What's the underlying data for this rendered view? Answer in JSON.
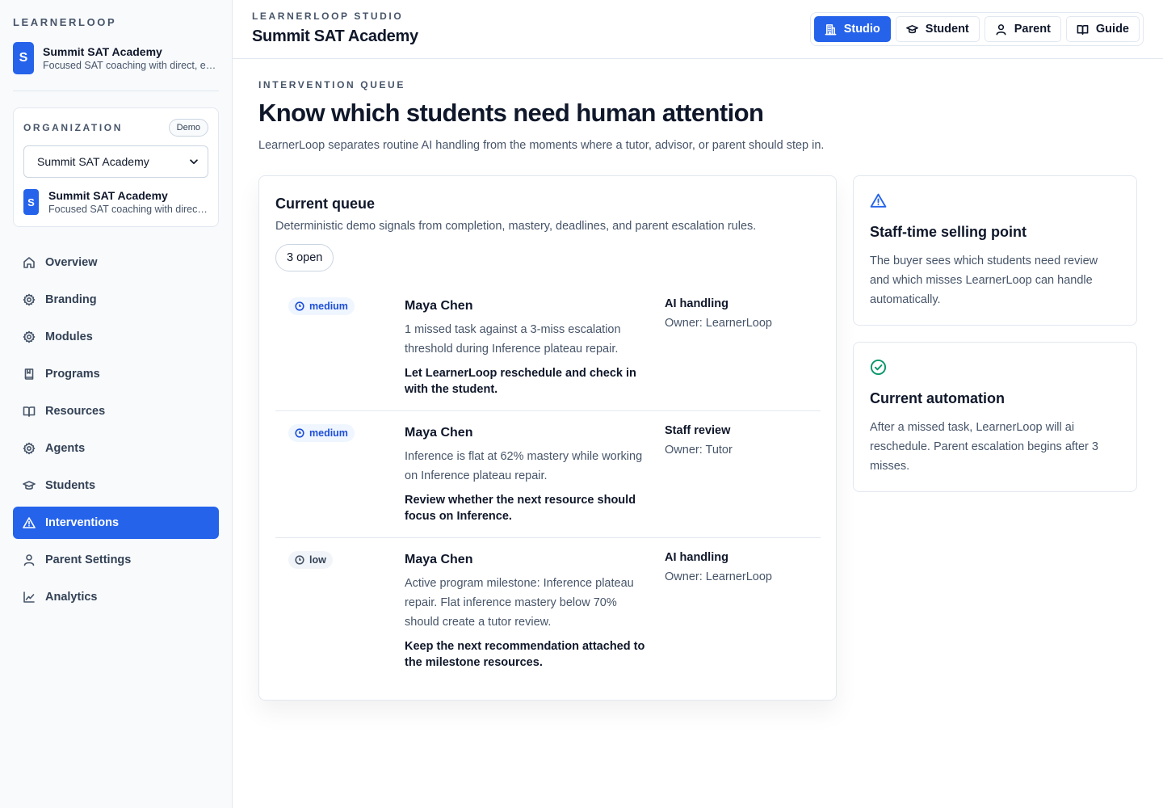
{
  "sidebar": {
    "brand": "LEARNERLOOP",
    "org_avatar_letter": "S",
    "org_name": "Summit SAT Academy",
    "org_description": "Focused SAT coaching with direct, e…",
    "org_card": {
      "label": "ORGANIZATION",
      "badge": "Demo",
      "selected_org": "Summit SAT Academy",
      "avatar_letter": "S",
      "name": "Summit SAT Academy",
      "description": "Focused SAT coaching with direc…"
    },
    "nav": [
      {
        "label": "Overview",
        "icon": "home-icon"
      },
      {
        "label": "Branding",
        "icon": "gear-icon"
      },
      {
        "label": "Modules",
        "icon": "gear-icon"
      },
      {
        "label": "Programs",
        "icon": "book-closed-icon"
      },
      {
        "label": "Resources",
        "icon": "book-open-icon"
      },
      {
        "label": "Agents",
        "icon": "gear-icon"
      },
      {
        "label": "Students",
        "icon": "graduation-cap-icon"
      },
      {
        "label": "Interventions",
        "icon": "warning-triangle-icon",
        "active": true
      },
      {
        "label": "Parent Settings",
        "icon": "user-icon"
      },
      {
        "label": "Analytics",
        "icon": "line-chart-icon"
      }
    ]
  },
  "header": {
    "eyebrow": "LEARNERLOOP STUDIO",
    "title": "Summit SAT Academy",
    "modes": [
      {
        "label": "Studio",
        "icon": "building-icon",
        "active": true
      },
      {
        "label": "Student",
        "icon": "graduation-cap-icon"
      },
      {
        "label": "Parent",
        "icon": "user-icon"
      },
      {
        "label": "Guide",
        "icon": "book-open-icon"
      }
    ]
  },
  "main": {
    "eyebrow": "INTERVENTION QUEUE",
    "title": "Know which students need human attention",
    "subtitle": "LearnerLoop separates routine AI handling from the moments where a tutor, advisor, or parent should step in."
  },
  "queue": {
    "title": "Current queue",
    "subtitle": "Deterministic demo signals from completion, mastery, deadlines, and parent escalation rules.",
    "open_count": "3 open",
    "items": [
      {
        "severity": "medium",
        "student": "Maya Chen",
        "reason": "1 missed task against a 3-miss escalation threshold during Inference plateau repair.",
        "action": "Let LearnerLoop reschedule and check in with the student.",
        "handling": "AI handling",
        "owner": "Owner: LearnerLoop"
      },
      {
        "severity": "medium",
        "student": "Maya Chen",
        "reason": "Inference is flat at 62% mastery while working on Inference plateau repair.",
        "action": "Review whether the next resource should focus on Inference.",
        "handling": "Staff review",
        "owner": "Owner: Tutor"
      },
      {
        "severity": "low",
        "student": "Maya Chen",
        "reason": "Active program milestone: Inference plateau repair. Flat inference mastery below 70% should create a tutor review.",
        "action": "Keep the next recommendation attached to the milestone resources.",
        "handling": "AI handling",
        "owner": "Owner: LearnerLoop"
      }
    ]
  },
  "side_cards": [
    {
      "icon": "warning-triangle-icon",
      "title": "Staff-time selling point",
      "body": "The buyer sees which students need review and which misses LearnerLoop can handle automatically."
    },
    {
      "icon": "check-circle-icon",
      "title": "Current automation",
      "body": "After a missed task, LearnerLoop will ai reschedule. Parent escalation begins after 3 misses."
    }
  ],
  "colors": {
    "accent": "#2563eb",
    "success": "#059669",
    "medium_badge_bg": "#eff6ff",
    "low_badge_bg": "#f1f5f9"
  }
}
